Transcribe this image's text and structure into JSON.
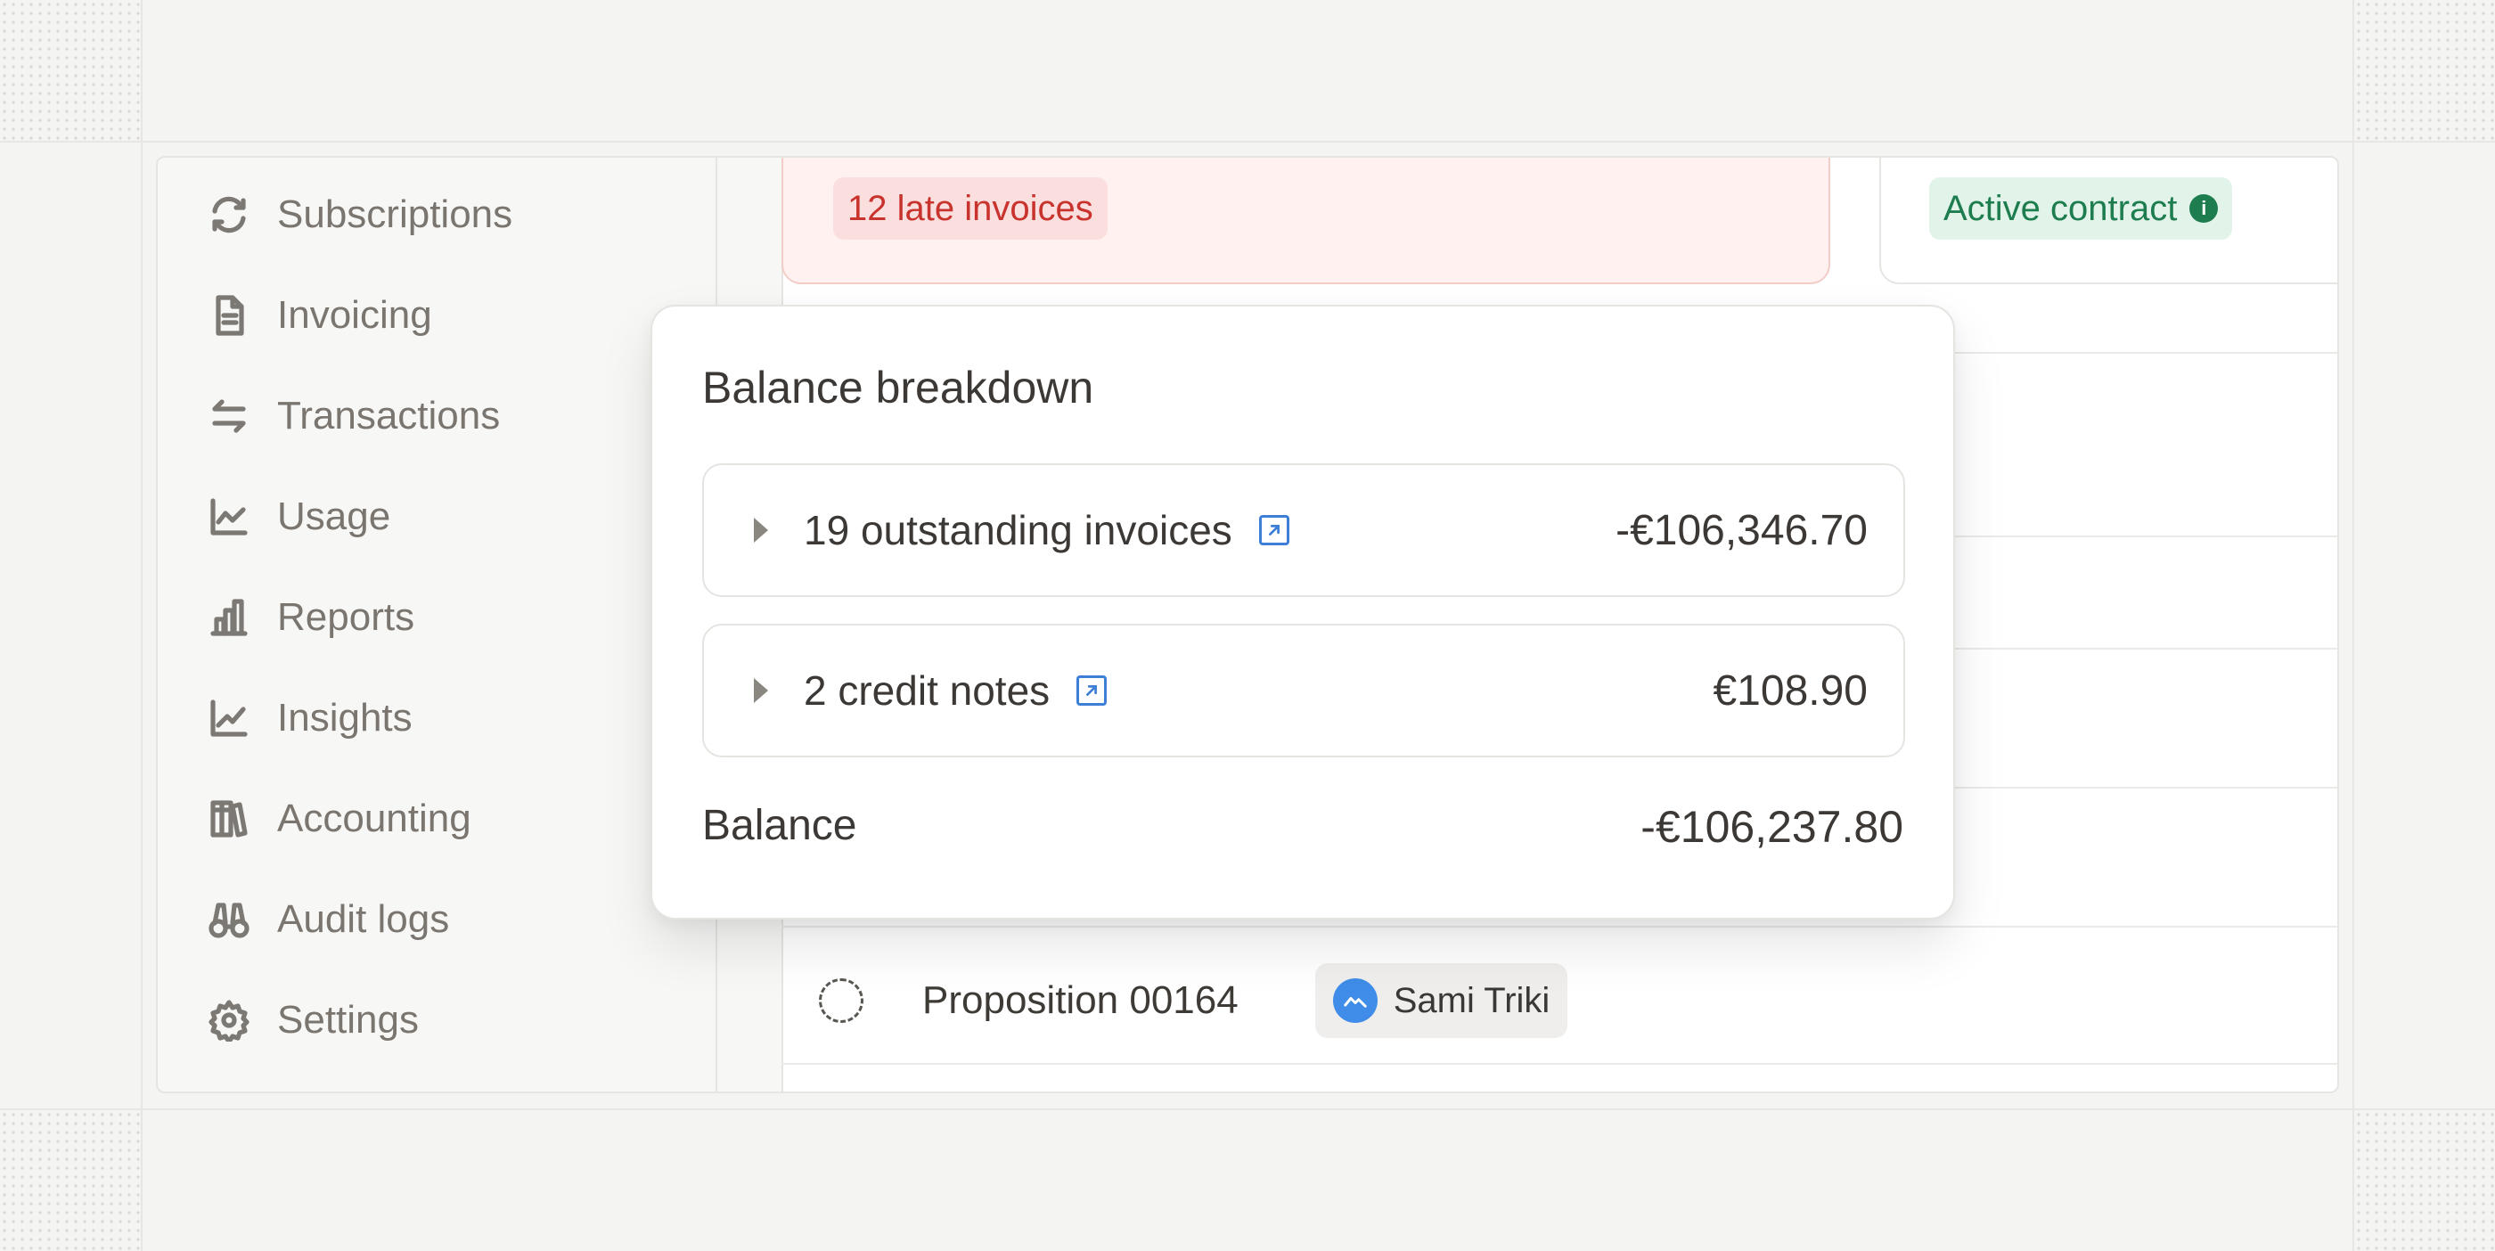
{
  "sidebar": {
    "items": [
      {
        "label": "Subscriptions",
        "icon": "refresh-icon"
      },
      {
        "label": "Invoicing",
        "icon": "document-icon"
      },
      {
        "label": "Transactions",
        "icon": "arrows-left-right-icon"
      },
      {
        "label": "Usage",
        "icon": "line-chart-icon"
      },
      {
        "label": "Reports",
        "icon": "bar-chart-icon"
      },
      {
        "label": "Insights",
        "icon": "trend-up-icon"
      },
      {
        "label": "Accounting",
        "icon": "books-icon"
      },
      {
        "label": "Audit logs",
        "icon": "binoculars-icon"
      },
      {
        "label": "Settings",
        "icon": "gear-icon"
      }
    ]
  },
  "status_cards": {
    "late_invoices": "12 late invoices",
    "contract": "Active contract"
  },
  "list": {
    "row": {
      "name": "Proposition 00164",
      "user": "Sami Triki"
    }
  },
  "popover": {
    "title": "Balance breakdown",
    "rows": [
      {
        "label": "19 outstanding invoices",
        "amount": "-€106,346.70"
      },
      {
        "label": "2 credit notes",
        "amount": "€108.90"
      }
    ],
    "balance_label": "Balance",
    "balance_amount": "-€106,237.80"
  },
  "colors": {
    "late_text": "#c8332d",
    "late_bg": "#fbdede",
    "contract_text": "#1e7d4f",
    "contract_bg": "#e2f3ea",
    "link_blue": "#3d7fd6",
    "avatar_blue": "#3f8de8"
  }
}
